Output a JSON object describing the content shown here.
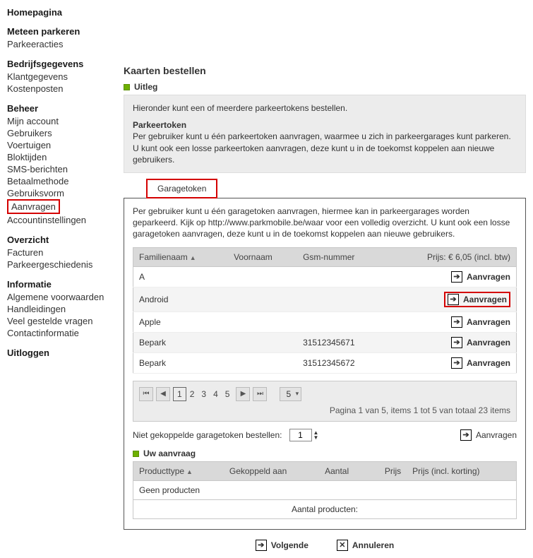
{
  "nav": {
    "s0": {
      "title": "Homepagina"
    },
    "s1": {
      "title": "Meteen parkeren",
      "items": [
        "Parkeeracties"
      ]
    },
    "s2": {
      "title": "Bedrijfsgegevens",
      "items": [
        "Klantgegevens",
        "Kostenposten"
      ]
    },
    "s3": {
      "title": "Beheer",
      "items": [
        "Mijn account",
        "Gebruikers",
        "Voertuigen",
        "Bloktijden",
        "SMS-berichten",
        "Betaalmethode",
        "Gebruiksvorm",
        "Aanvragen",
        "Accountinstellingen"
      ]
    },
    "s4": {
      "title": "Overzicht",
      "items": [
        "Facturen",
        "Parkeergeschiedenis"
      ]
    },
    "s5": {
      "title": "Informatie",
      "items": [
        "Algemene voorwaarden",
        "Handleidingen",
        "Veel gestelde vragen",
        "Contactinformatie"
      ]
    },
    "s6": {
      "title": "Uitloggen"
    }
  },
  "page": {
    "title": "Kaarten bestellen",
    "section_uitleg": "Uitleg",
    "info_intro": "Hieronder kunt een of meerdere parkeertokens bestellen.",
    "info_sub": "Parkeertoken",
    "info_body": "Per gebruiker kunt u één parkeertoken aanvragen, waarmee u zich in parkeergarages kunt parkeren. U kunt ook een losse parkeertoken aanvragen, deze kunt u in de toekomst koppelen aan nieuwe gebruikers.",
    "tab_label": "Garagetoken",
    "panel_intro": "Per gebruiker kunt u één garagetoken aanvragen, hiermee kan in parkeergarages worden geparkeerd. Kijk op http://www.parkmobile.be/waar voor een volledig overzicht. U kunt ook een losse garagetoken aanvragen, deze kunt u in de toekomst koppelen aan nieuwe gebruikers.",
    "cols": {
      "familienaam": "Familienaam",
      "voornaam": "Voornaam",
      "gsm": "Gsm-nummer",
      "prijs": "Prijs: € 6,05 (incl. btw)"
    },
    "rows": [
      {
        "fn": "A",
        "vn": "",
        "gsm": "",
        "btn": "Aanvragen",
        "hl": false
      },
      {
        "fn": "Android",
        "vn": "",
        "gsm": "",
        "btn": "Aanvragen",
        "hl": true
      },
      {
        "fn": "Apple",
        "vn": "",
        "gsm": "",
        "btn": "Aanvragen",
        "hl": false
      },
      {
        "fn": "Bepark",
        "vn": "",
        "gsm": "31512345671",
        "btn": "Aanvragen",
        "hl": false
      },
      {
        "fn": "Bepark",
        "vn": "",
        "gsm": "31512345672",
        "btn": "Aanvragen",
        "hl": false
      }
    ],
    "pager": {
      "pages": [
        "1",
        "2",
        "3",
        "4",
        "5"
      ],
      "active": "1",
      "page_size": "5",
      "info": "Pagina 1 van 5, items 1 tot 5 van totaal 23 items"
    },
    "order": {
      "label": "Niet gekoppelde garagetoken bestellen:",
      "qty": "1",
      "btn": "Aanvragen"
    },
    "section_aanvraag": "Uw aanvraag",
    "cols2": {
      "type": "Producttype",
      "gekoppeld": "Gekoppeld aan",
      "aantal": "Aantal",
      "prijs": "Prijs",
      "prijs_k": "Prijs (incl. korting)"
    },
    "empty": "Geen producten",
    "total_label": "Aantal producten:",
    "footer": {
      "next": "Volgende",
      "cancel": "Annuleren"
    }
  }
}
